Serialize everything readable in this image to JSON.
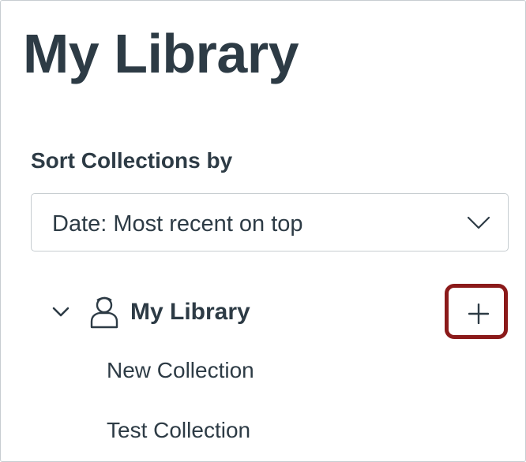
{
  "page": {
    "title": "My Library"
  },
  "sort": {
    "label": "Sort Collections by",
    "selected": "Date: Most recent on top",
    "icon": "chevron-down-icon"
  },
  "tree": {
    "root": {
      "label": "My Library",
      "expanded": true,
      "icon": "user-icon",
      "toggle_icon": "chevron-down-icon",
      "add_icon": "plus-icon",
      "highlight_color": "#8b1a1a"
    },
    "collections": [
      {
        "label": "New Collection"
      },
      {
        "label": "Test Collection"
      }
    ]
  },
  "colors": {
    "text": "#2d3b45",
    "border": "#c7cdd1",
    "highlight": "#8b1a1a"
  }
}
